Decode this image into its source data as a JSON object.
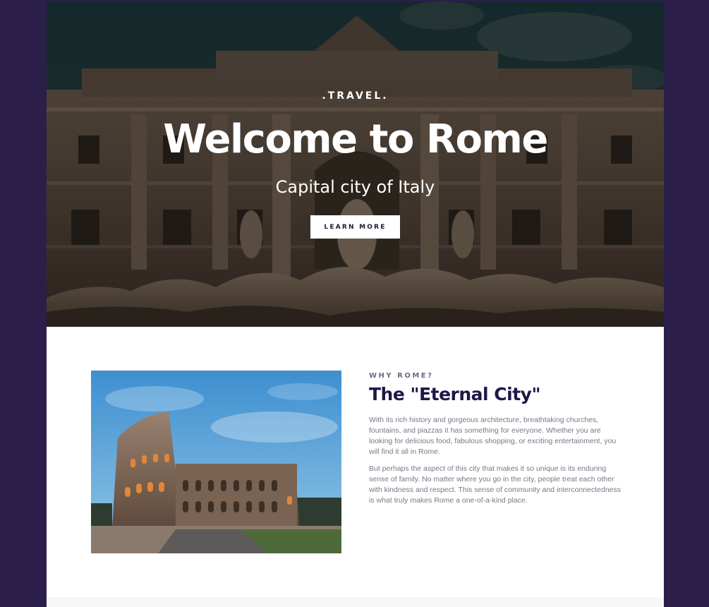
{
  "hero": {
    "eyebrow": ".TRAVEL.",
    "title": "Welcome to Rome",
    "subtitle": "Capital city of Italy",
    "cta_label": "LEARN MORE",
    "background_image": "trevi-fountain-photo"
  },
  "about": {
    "kicker": "WHY ROME?",
    "heading": "The \"Eternal City\"",
    "paragraphs": [
      "With its rich history and gorgeous architecture, breathtaking churches, fountains, and piazzas it has something for everyone. Whether you are looking for delicious food, fabulous shopping, or exciting entertainment, you will find it all in Rome.",
      "But perhaps the aspect of this city that makes it so unique is its enduring sense of family. No matter where you go in the city, people treat each other with kindness and respect. This sense of community and interconnectedness is what truly makes Rome a one-of-a-kind place."
    ],
    "image": "colosseum-photo"
  },
  "colors": {
    "page_background": "#2b1f4a",
    "heading": "#1f1846",
    "body_text": "#7a7686",
    "kicker": "#6e6a80",
    "button_background": "#ffffff",
    "button_text": "#1f1a33"
  }
}
